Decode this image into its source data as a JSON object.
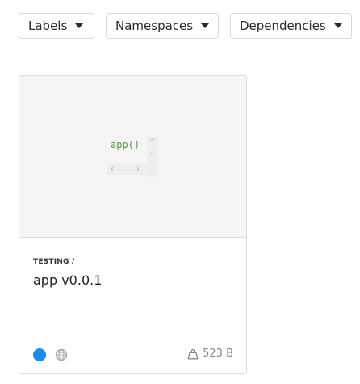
{
  "filters": {
    "labels": "Labels",
    "namespaces": "Namespaces",
    "dependencies": "Dependencies"
  },
  "card": {
    "preview_code": "app()",
    "namespace": "TESTING /",
    "title": "app v0.0.1",
    "size": "523 B",
    "status_color": "#1a8cf0",
    "icons": [
      "globe-icon",
      "weight-icon"
    ]
  }
}
